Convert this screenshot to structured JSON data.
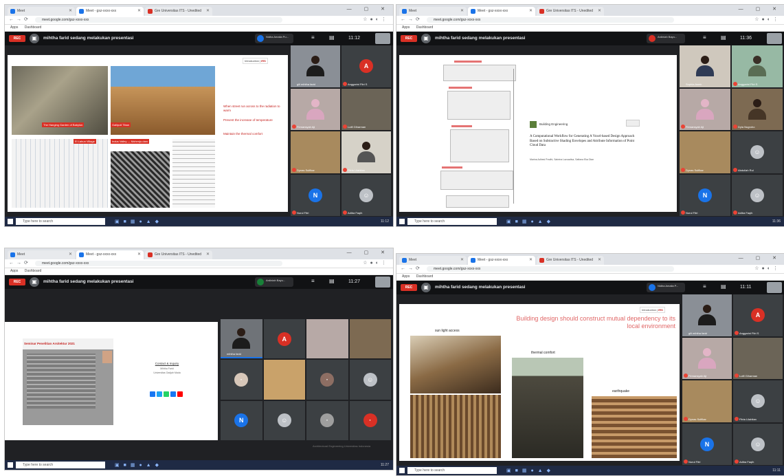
{
  "browser": {
    "tabs": [
      "Meet",
      "Meet - gsz-xxxx-xxx",
      "Gre Universitas ITS - Unedited"
    ],
    "url": "meet.google.com/gsz-xxxx-xxx",
    "bookmarks": [
      "Apps",
      "Dashboard"
    ],
    "window_controls": "— ▢ ✕"
  },
  "meet": {
    "rec_label": "REC",
    "presenting_text": "mihtha farid sedang melakukan presentasi"
  },
  "taskbar": {
    "search_placeholder": "Type here to search"
  },
  "screens": [
    {
      "clock": "11:12",
      "presenter_chip": "Nidha Amalia Pu...",
      "slide": {
        "tag": "Introduction",
        "tag_highlight": "IRS",
        "captions": [
          "The Hanging Garden of Babylon",
          "Gallipoli Tiban",
          "El Lahun Village",
          "Indus Valley — Mohenjo-daro"
        ],
        "points": [
          "When street run across to the radiation to warm",
          "Prevent the increase of temperature",
          "Maintain the thermal comfort"
        ]
      },
      "participants": [
        "gili mihtha farid",
        "Anggarini Fitri S",
        "Firmansyah Aji",
        "Lutfi Giharman",
        "Dynas Sulfikar",
        "Fitria Lilahitan",
        "Nurul Fitri",
        "Adiba Faqih"
      ]
    },
    {
      "clock": "11:36",
      "presenter_chip": "Ardiniah Bayu...",
      "slide": {
        "journal": "Building Engineering",
        "paper_title": "A Computational Workflow for Generating A Voxel-based Design Approach Based on Subtractive Shading Envelopes and Attribute Information of Point Cloud Data",
        "authors": "Marina Adhesi Pradhi, Sabrina Lazuadiva, Safiana Eka Dian"
      },
      "participants": [
        "Sophia Asmir",
        "Anggarini Fitri S",
        "Firmansyah Aji",
        "Dyla Nugroho",
        "Dynas Sulfikar",
        "Abdullah Rul",
        "Nurul Fitri",
        "Adiba Faqih",
        "Annabel Sahitan"
      ]
    },
    {
      "clock": "11:27",
      "presenter_chip": "Ardiniah Bayu...",
      "slide": {
        "banner": "Seminar Penelitian Arsitektur 2021",
        "contact_title": "Contact & Inquiry",
        "contact_lines": [
          "Mihtha Farid",
          "Universitas Gadjah Mada"
        ],
        "footer": "Architectural Engineering Universitas Indonesia"
      },
      "participants": [
        "mihtha farid",
        "",
        "",
        "",
        "",
        "",
        "",
        "",
        "",
        "",
        "",
        ""
      ]
    },
    {
      "clock": "11:11",
      "presenter_chip": "Nidha Amalia P...",
      "slide": {
        "tag": "Introduction",
        "tag_highlight": "IRS",
        "heading": "Building design should construct mutual dependency to its local environment",
        "labels": [
          "sun light access",
          "thermal comfort",
          "earthquake"
        ]
      },
      "participants": [
        "gili mihtha farid",
        "Anggarini Fitri S",
        "Firmansyah Aji",
        "Lutfi Giharman",
        "Dynas Sulfikar",
        "Fitria Lilahitan",
        "Nurul Fitri",
        "Adiba Faqih"
      ]
    }
  ]
}
